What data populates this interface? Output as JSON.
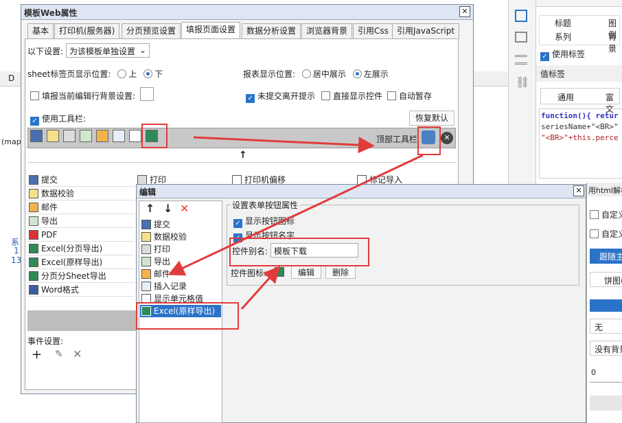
{
  "bg": {
    "col_header": "D",
    "text_fragment": "(mapa",
    "left_labels": [
      "系",
      "1",
      "13"
    ]
  },
  "main_dialog": {
    "title": "模板Web属性",
    "close": "✕",
    "tabs": [
      "基本",
      "打印机(服务器)",
      "分页预览设置",
      "填报页面设置",
      "数据分析设置",
      "浏览器背景",
      "引用Css",
      "引用JavaScript"
    ],
    "settings_label": "以下设置:",
    "settings_select": "为该模板单独设置",
    "sheet_pos_label": "sheet标签页显示位置:",
    "sheet_pos_options": [
      "上",
      "下"
    ],
    "report_pos_label": "报表显示位置:",
    "report_pos_options": [
      "居中展示",
      "左展示"
    ],
    "fill_bg_label": "填报当前编辑行背景设置:",
    "unsubmitted_label": "未提交离开提示",
    "direct_show_label": "直接显示控件",
    "autosave_label": "自动暂存",
    "use_toolbar_label": "使用工具栏:",
    "restore_default": "恢复默认",
    "top_toolbar_label": "顶部工具栏",
    "up_arrow": "↑",
    "grid_items": [
      "打印",
      "打印机偏移",
      "标记导入"
    ],
    "list_items": [
      "提交",
      "数据校验",
      "邮件",
      "导出",
      "PDF",
      "Excel(分页导出)",
      "Excel(原样导出)",
      "分页分Sheet导出",
      "Word格式"
    ],
    "event_label": "事件设置:"
  },
  "edit_dialog": {
    "title": "编辑",
    "close": "✕",
    "tree_items": [
      "提交",
      "数据校验",
      "打印",
      "导出",
      "邮件",
      "插入记录",
      "显示单元格值",
      "Excel(原样导出)"
    ],
    "group_title": "设置表单按钮属性",
    "show_icon": "显示按钮图标",
    "show_name": "显示按钮名字",
    "alias_label": "控件别名:",
    "alias_value": "模板下载",
    "icon_label": "控件图标:",
    "edit_btn": "编辑",
    "delete_btn": "删除"
  },
  "right_panel": {
    "icons": [
      "panel-icon",
      "window-icon",
      "list-icon",
      "link-icon"
    ],
    "title_label": "标题",
    "legend_label": "图例",
    "series_label": "系列",
    "bg_label": "背景",
    "use_label": "使用标签",
    "value_label": "值标签",
    "general": "通用",
    "rich_text": "富文",
    "code_lines": [
      "function(){ retur",
      "seriesName+\"<BR>\"",
      "\"<BR>\"+this.perce"
    ],
    "html_parse": "用html解析",
    "custom1": "自定义",
    "custom2": "自定义",
    "follow_main": "跟随主",
    "pie_chart": "饼图(",
    "none": "无",
    "no_bg": "没有背景",
    "zero": "0"
  }
}
